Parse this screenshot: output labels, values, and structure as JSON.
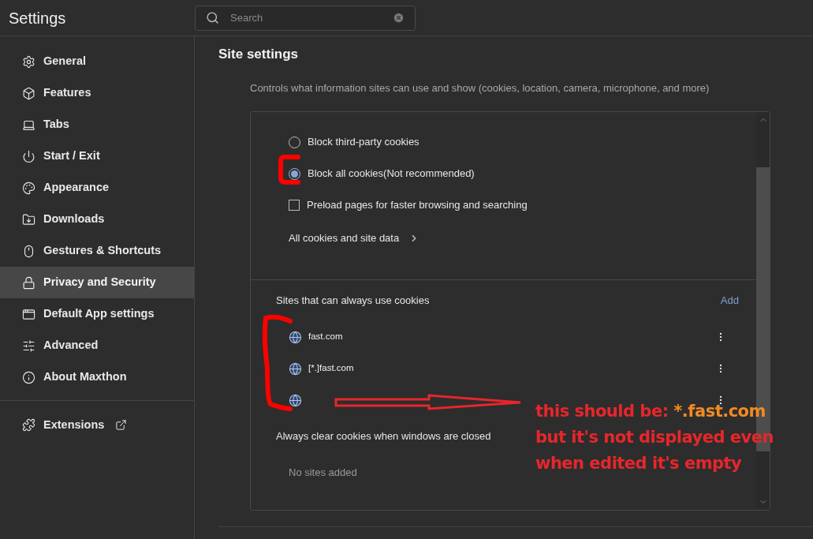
{
  "window": {
    "title": "Settings"
  },
  "search": {
    "placeholder": "Search"
  },
  "sidebar": {
    "items": [
      {
        "label": "General",
        "selected": false
      },
      {
        "label": "Features",
        "selected": false
      },
      {
        "label": "Tabs",
        "selected": false
      },
      {
        "label": "Start / Exit",
        "selected": false
      },
      {
        "label": "Appearance",
        "selected": false
      },
      {
        "label": "Downloads",
        "selected": false
      },
      {
        "label": "Gestures & Shortcuts",
        "selected": false
      },
      {
        "label": "Privacy and Security",
        "selected": true
      },
      {
        "label": "Default App settings",
        "selected": false
      },
      {
        "label": "Advanced",
        "selected": false
      },
      {
        "label": "About Maxthon",
        "selected": false
      }
    ],
    "extensions": {
      "label": "Extensions"
    }
  },
  "page": {
    "title": "Site settings",
    "description": "Controls what information sites can use and show (cookies, location, camera, microphone, and more)"
  },
  "cookie_options": [
    {
      "kind": "radio",
      "label": "Block third-party cookies",
      "selected": false
    },
    {
      "kind": "radio",
      "label": "Block all cookies(Not recommended)",
      "selected": true
    },
    {
      "kind": "checkbox",
      "label": "Preload pages for faster browsing and searching",
      "checked": false
    },
    {
      "kind": "link",
      "label": "All cookies and site data"
    }
  ],
  "sections": [
    {
      "title": "Sites that can always use cookies",
      "add": "Add",
      "sites": [
        {
          "kind": "named",
          "name": "fast.com"
        },
        {
          "kind": "named",
          "name": "[*.]fast.com"
        },
        {
          "kind": "unnamed"
        }
      ]
    },
    {
      "title": "Always clear cookies when windows are closed",
      "empty": "No sites added"
    }
  ],
  "annotation": {
    "lines": [
      [
        {
          "text": "this should be: ",
          "color": "#e8262b"
        },
        {
          "text": "*.fast.com",
          "color": "#f28a22"
        }
      ],
      [
        {
          "text": "but it's not displayed even",
          "color": "#e8262b"
        }
      ],
      [
        {
          "text": "when edited it's empty",
          "color": "#e8262b"
        }
      ]
    ]
  }
}
